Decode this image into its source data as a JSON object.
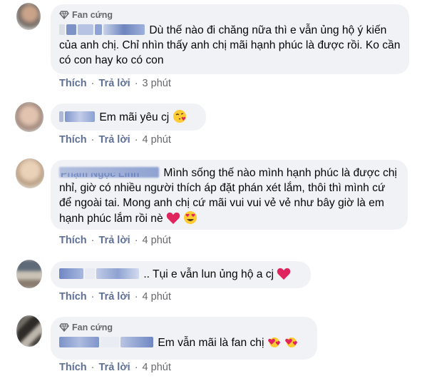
{
  "comments": [
    {
      "badge": "Fan cứng",
      "text": "Dù thế nào đi chăng nữa thì e vẫn ủng hộ ý kiến của anh chị. Chỉ nhìn thấy anh chị mãi hạnh phúc là được rồi. Ko cần có con hay ko có con",
      "like": "Thích",
      "reply": "Trả lời",
      "time": "3 phút"
    },
    {
      "text": "Em mãi yêu cj",
      "emoji": "kiss-heart-emoji",
      "like": "Thích",
      "reply": "Trả lời",
      "time": "4 phút"
    },
    {
      "author_partial": "Phạm Ngọc Linh",
      "text": "Mình sống thế nào mình hạnh phúc là được chị nhỉ, giờ có nhiều người thích áp đặt phán xét lắm, thôi thì mình cứ để ngoài tai. Mong anh chị cứ mãi vui vui vẻ vẻ như bây giờ là em hạnh phúc lắm rồi nè",
      "emoji": [
        "red-heart-emoji",
        "heart-eyes-emoji"
      ],
      "like": "Thích",
      "reply": "Trả lời",
      "time": "4 phút"
    },
    {
      "text": ".. Tụi e vẫn lun ủng hộ a cj",
      "emoji": "red-heart-emoji",
      "like": "Thích",
      "reply": "Trả lời",
      "time": "4 phút"
    },
    {
      "badge": "Fan cứng",
      "text": "Em vẫn mãi là fan chị",
      "emoji": [
        "hearts-emoji",
        "hearts-emoji"
      ],
      "like": "Thích",
      "reply": "Trả lời",
      "time": "4 phút"
    }
  ],
  "separator": "·",
  "colors": {
    "bubble": "#f0f2f5",
    "action_link": "#5f7095",
    "meta": "#65676b",
    "blur_name": "#8fa6d8",
    "heart": "#e0245e"
  }
}
